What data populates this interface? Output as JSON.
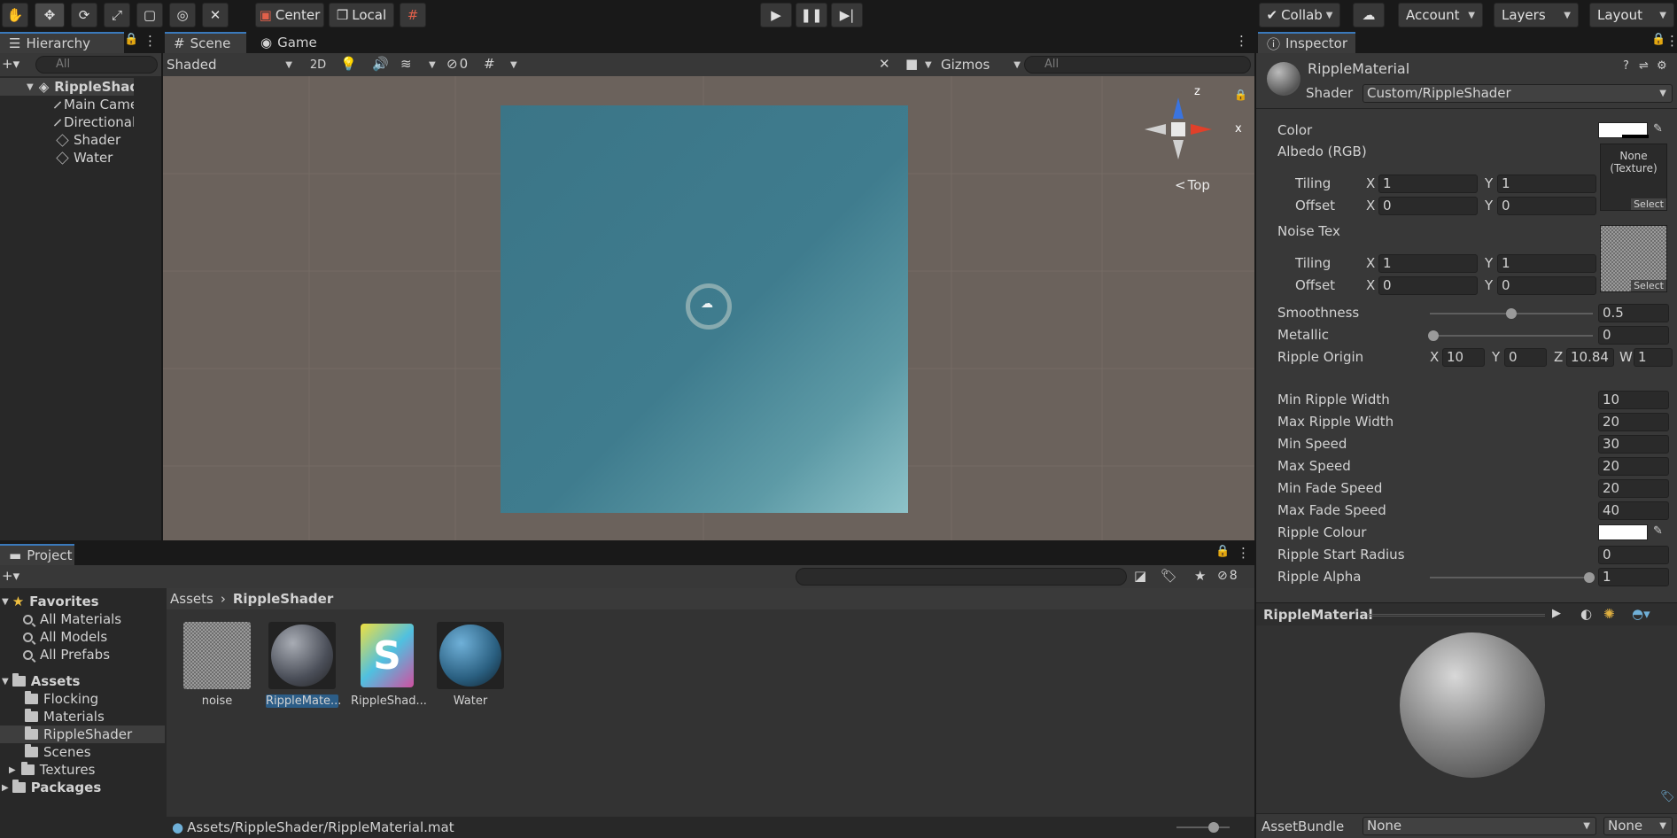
{
  "toolbar": {
    "pivot_label": "Center",
    "space_label": "Local",
    "collab_label": "Collab",
    "account_label": "Account",
    "layers_label": "Layers",
    "layout_label": "Layout"
  },
  "hierarchy": {
    "tab_label": "Hierarchy",
    "search_placeholder": "All",
    "scene_name": "RippleShade",
    "items": [
      "Main Camera",
      "Directional Li",
      "Shader",
      "Water"
    ]
  },
  "scene_view": {
    "tabs": [
      "Scene",
      "Game"
    ],
    "draw_mode": "Shaded",
    "mode_2d": "2D",
    "hidden_count": "0",
    "gizmos_label": "Gizmos",
    "search_placeholder": "All",
    "view_label": "Top",
    "axis_z": "z",
    "axis_x": "x",
    "water_color": "#3d7a8c",
    "background_color": "#6b625c"
  },
  "project": {
    "tab_label": "Project",
    "hidden_count": "8",
    "favorites_label": "Favorites",
    "favorites": [
      "All Materials",
      "All Models",
      "All Prefabs"
    ],
    "assets_label": "Assets",
    "folders": [
      "Flocking",
      "Materials",
      "RippleShader",
      "Scenes",
      "Textures"
    ],
    "packages_label": "Packages",
    "breadcrumb": [
      "Assets",
      "RippleShader"
    ],
    "asset_items": [
      "noise",
      "RippleMate...",
      "RippleShad...",
      "Water"
    ],
    "status_path": "Assets/RippleShader/RippleMaterial.mat"
  },
  "inspector": {
    "tab_label": "Inspector",
    "material_name": "RippleMaterial",
    "shader_label": "Shader",
    "shader_value": "Custom/RippleShader",
    "color_label": "Color",
    "albedo_label": "Albedo (RGB)",
    "albedo_texture": [
      "None",
      "(Texture)"
    ],
    "select_label": "Select",
    "tiling_label": "Tiling",
    "offset_label": "Offset",
    "axis_x": "X",
    "axis_y": "Y",
    "axis_z": "Z",
    "axis_w": "W",
    "albedo_tiling": [
      "1",
      "1"
    ],
    "albedo_offset": [
      "0",
      "0"
    ],
    "noise_label": "Noise Tex",
    "noise_tiling": [
      "1",
      "1"
    ],
    "noise_offset": [
      "0",
      "0"
    ],
    "smoothness_label": "Smoothness",
    "smoothness_value": "0.5",
    "metallic_label": "Metallic",
    "metallic_value": "0",
    "ripple_origin_label": "Ripple Origin",
    "ripple_origin": [
      "10",
      "0",
      "10.84",
      "1"
    ],
    "props": [
      {
        "label": "Min Ripple Width",
        "value": "10"
      },
      {
        "label": "Max Ripple Width",
        "value": "20"
      },
      {
        "label": "Min Speed",
        "value": "30"
      },
      {
        "label": "Max Speed",
        "value": "20"
      },
      {
        "label": "Min Fade Speed",
        "value": "20"
      },
      {
        "label": "Max Fade Speed",
        "value": "40"
      }
    ],
    "ripple_colour_label": "Ripple Colour",
    "ripple_start_radius_label": "Ripple Start Radius",
    "ripple_start_radius_value": "0",
    "ripple_alpha_label": "Ripple Alpha",
    "ripple_alpha_value": "1",
    "preview_title": "RippleMaterial",
    "assetbundle_label": "AssetBundle",
    "assetbundle_value": "None",
    "assetbundle_variant": "None",
    "accent_color": "#3a79bb"
  }
}
